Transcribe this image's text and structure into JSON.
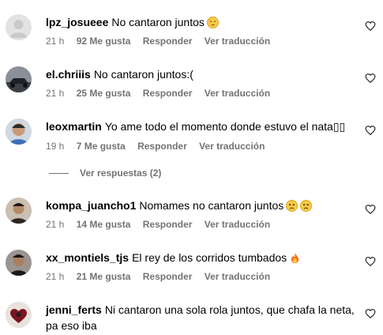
{
  "comments": [
    {
      "user": "lpz_josueee",
      "text": "No cantaron juntos",
      "emoji": "pensive",
      "time": "21 h",
      "likes": "92 Me gusta",
      "reply": "Responder",
      "translate": "Ver traducción"
    },
    {
      "user": "el.chriiis",
      "text": "No cantaron juntos:(",
      "time": "21 h",
      "likes": "25 Me gusta",
      "reply": "Responder",
      "translate": "Ver traducción"
    },
    {
      "user": "leoxmartin",
      "text": "Yo ame todo el momento donde estuvo el nata▯▯",
      "time": "19 h",
      "likes": "7 Me gusta",
      "reply": "Responder",
      "translate": "Ver traducción"
    },
    {
      "user": "kompa_juancho1",
      "text": "Nomames no cantaron juntos",
      "emoji": "crying x2",
      "time": "21 h",
      "likes": "14 Me gusta",
      "reply": "Responder",
      "translate": "Ver traducción"
    },
    {
      "user": "xx_montiels_tjs",
      "text": "El rey de los corridos tumbados",
      "emoji": "fire",
      "time": "21 h",
      "likes": "21 Me gusta",
      "reply": "Responder",
      "translate": "Ver traducción"
    },
    {
      "user": "jenni_ferts",
      "text": "Ni cantaron una sola rola juntos, que chafa la neta, pa eso iba"
    }
  ],
  "view_replies": "Ver respuestas (2)",
  "colors": {
    "meta": "#737373",
    "text": "#000000",
    "background": "#ffffff"
  }
}
